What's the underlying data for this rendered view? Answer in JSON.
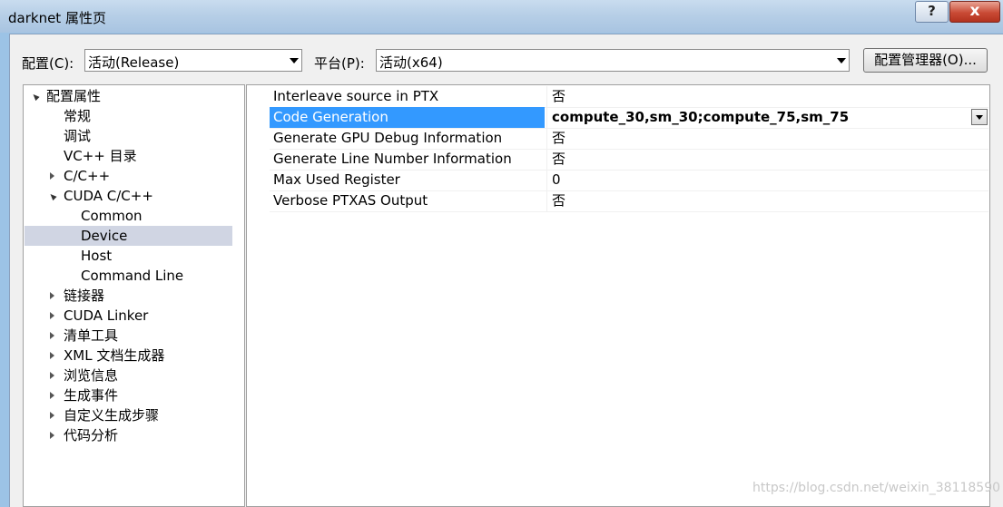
{
  "window": {
    "title": "darknet 属性页",
    "help_label": "?",
    "close_label": "x"
  },
  "toolbar": {
    "config_label": "配置(C):",
    "config_value": "活动(Release)",
    "platform_label": "平台(P):",
    "platform_value": "活动(x64)",
    "config_manager_label": "配置管理器(O)..."
  },
  "tree": [
    {
      "label": "配置属性",
      "level": 0,
      "expander": "open"
    },
    {
      "label": "常规",
      "level": 1,
      "expander": "none"
    },
    {
      "label": "调试",
      "level": 1,
      "expander": "none"
    },
    {
      "label": "VC++ 目录",
      "level": 1,
      "expander": "none"
    },
    {
      "label": "C/C++",
      "level": 1,
      "expander": "collapsed"
    },
    {
      "label": "CUDA C/C++",
      "level": 1,
      "expander": "open"
    },
    {
      "label": "Common",
      "level": 2,
      "expander": "none"
    },
    {
      "label": "Device",
      "level": 2,
      "expander": "none",
      "selected": true
    },
    {
      "label": "Host",
      "level": 2,
      "expander": "none"
    },
    {
      "label": "Command Line",
      "level": 2,
      "expander": "none"
    },
    {
      "label": "链接器",
      "level": 1,
      "expander": "collapsed"
    },
    {
      "label": "CUDA Linker",
      "level": 1,
      "expander": "collapsed"
    },
    {
      "label": "清单工具",
      "level": 1,
      "expander": "collapsed"
    },
    {
      "label": "XML 文档生成器",
      "level": 1,
      "expander": "collapsed"
    },
    {
      "label": "浏览信息",
      "level": 1,
      "expander": "collapsed"
    },
    {
      "label": "生成事件",
      "level": 1,
      "expander": "collapsed"
    },
    {
      "label": "自定义生成步骤",
      "level": 1,
      "expander": "collapsed"
    },
    {
      "label": "代码分析",
      "level": 1,
      "expander": "collapsed"
    }
  ],
  "properties": [
    {
      "name": "Interleave source in PTX",
      "value": "否"
    },
    {
      "name": "Code Generation",
      "value": "compute_30,sm_30;compute_75,sm_75",
      "selected": true
    },
    {
      "name": "Generate GPU Debug Information",
      "value": "否"
    },
    {
      "name": "Generate Line Number Information",
      "value": "否"
    },
    {
      "name": "Max Used Register",
      "value": "0"
    },
    {
      "name": "Verbose PTXAS Output",
      "value": "否"
    }
  ],
  "watermark": "https://blog.csdn.net/weixin_38118590",
  "colors": {
    "selection_highlight": "#3399ff",
    "tree_selection": "#d0d5e3",
    "title_bar": "#b7cfe7",
    "close_button": "#c94a35"
  }
}
